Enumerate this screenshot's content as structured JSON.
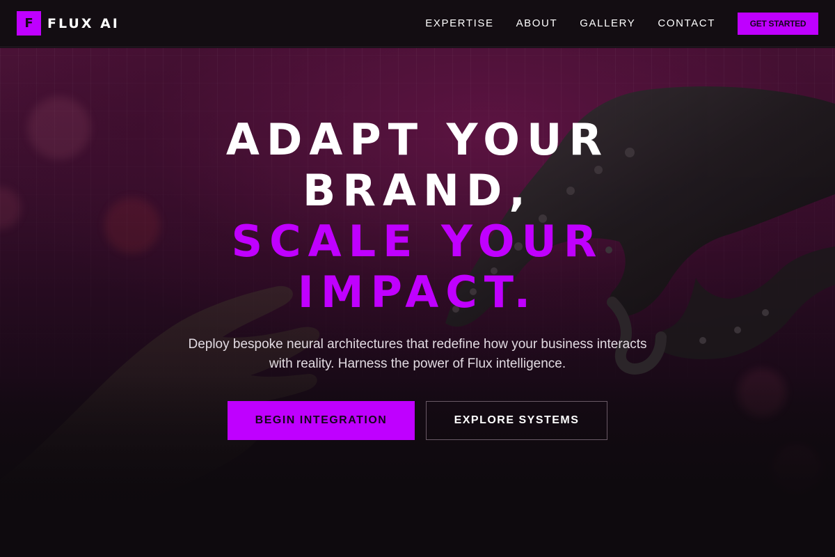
{
  "header": {
    "logo_letter": "F",
    "brand_name": "FLUX AI",
    "nav": [
      {
        "label": "EXPERTISE"
      },
      {
        "label": "ABOUT"
      },
      {
        "label": "GALLERY"
      },
      {
        "label": "CONTACT"
      }
    ],
    "cta_label": "GET STARTED"
  },
  "hero": {
    "headline_lines": [
      "ADAPT YOUR",
      "BRAND,",
      "SCALE YOUR",
      "IMPACT."
    ],
    "subtext": "Deploy bespoke neural architectures that redefine how your business interacts with reality. Harness the power of Flux intelligence.",
    "primary_button": "BEGIN INTEGRATION",
    "secondary_button": "EXPLORE SYSTEMS"
  },
  "colors": {
    "accent": "#bf00ff",
    "headline_purple": "#c000ff",
    "header_bg": "#130d12",
    "page_bg": "#0e0a0e"
  },
  "icons": [
    "logo-mark-icon"
  ]
}
